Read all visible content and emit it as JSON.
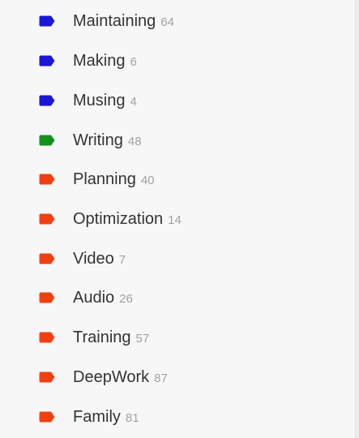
{
  "tags": [
    {
      "name": "Maintaining",
      "count": "64",
      "color": "#1a17d6"
    },
    {
      "name": "Making",
      "count": "6",
      "color": "#1a17d6"
    },
    {
      "name": "Musing",
      "count": "4",
      "color": "#1a17d6"
    },
    {
      "name": "Writing",
      "count": "48",
      "color": "#14901e"
    },
    {
      "name": "Planning",
      "count": "40",
      "color": "#f04012"
    },
    {
      "name": "Optimization",
      "count": "14",
      "color": "#f04012"
    },
    {
      "name": "Video",
      "count": "7",
      "color": "#f04012"
    },
    {
      "name": "Audio",
      "count": "26",
      "color": "#f04012"
    },
    {
      "name": "Training",
      "count": "57",
      "color": "#f04012"
    },
    {
      "name": "DeepWork",
      "count": "87",
      "color": "#f04012"
    },
    {
      "name": "Family",
      "count": "81",
      "color": "#f04012"
    }
  ]
}
